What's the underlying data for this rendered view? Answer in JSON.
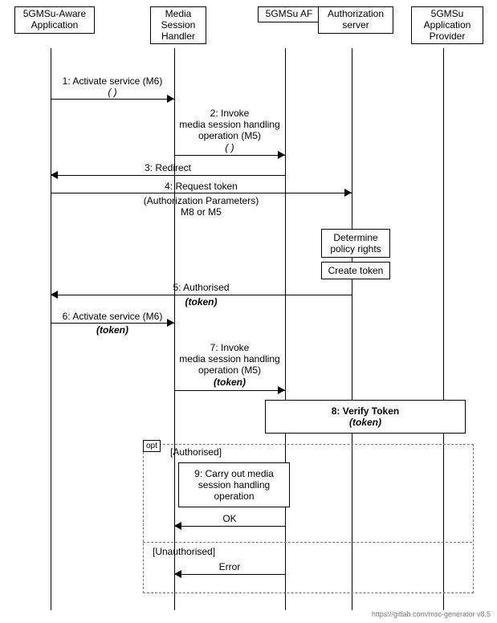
{
  "participants": {
    "p1": "5GMSu-Aware\nApplication",
    "p2": "Media\nSession\nHandler",
    "p3": "5GMSu AF",
    "p4": "Authorization\nserver",
    "p5": "5GMSu\nApplication\nProvider"
  },
  "messages": {
    "m1": "1: Activate service (M6)",
    "m1p": "( )",
    "m2": "2: Invoke\nmedia session handling\noperation (M5)",
    "m2p": "( )",
    "m3": "3: Redirect",
    "m4": "4: Request token",
    "m4s": "(Authorization Parameters)\nM8 or M5",
    "n1": "Determine\npolicy rights",
    "n2": "Create token",
    "m5": "5: Authorised",
    "m5p": "(token)",
    "m6": "6: Activate service (M6)",
    "m6p": "(token)",
    "m7": "7: Invoke\nmedia session handling\noperation (M5)",
    "m7p": "(token)",
    "inv8": "8: Verify Token",
    "inv8p": "(token)",
    "opt": "opt",
    "g1": "[Authorised]",
    "inv9": "9: Carry out\nmedia session handling\noperation",
    "ok": "OK",
    "g2": "[Unauthorised]",
    "err": "Error"
  },
  "footer": "https://gitlab.com/msc-generator v8.5"
}
